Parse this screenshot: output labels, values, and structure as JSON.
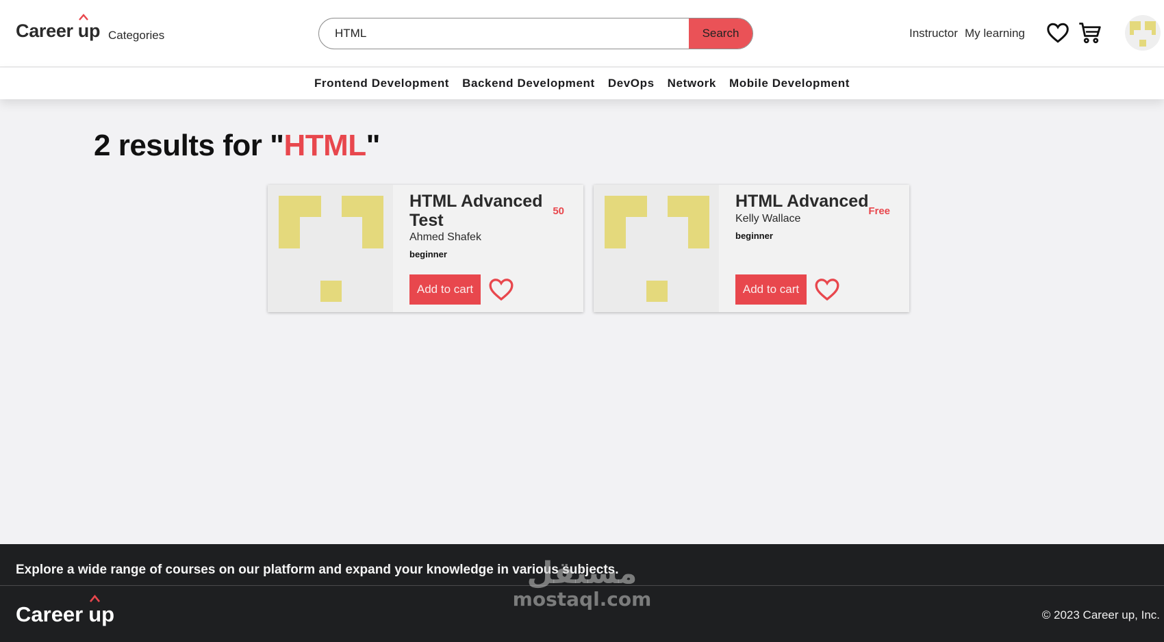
{
  "brand": {
    "name_part1": "Career",
    "name_part2": "up",
    "accent": "#e8474d",
    "logo_yellow": "#e4d97c"
  },
  "header": {
    "categories_label": "Categories",
    "search": {
      "value": "HTML",
      "button_label": "Search"
    },
    "nav": {
      "instructor": "Instructor",
      "my_learning": "My learning"
    },
    "icons": [
      "heart-icon",
      "cart-icon",
      "avatar"
    ]
  },
  "subnav": {
    "items": [
      {
        "label": "Frontend Development"
      },
      {
        "label": "Backend Development"
      },
      {
        "label": "DevOps"
      },
      {
        "label": "Network"
      },
      {
        "label": "Mobile Development"
      }
    ]
  },
  "results": {
    "count_text": "2 results for \"",
    "query": "HTML",
    "close_quote": "\""
  },
  "courses": [
    {
      "title": "HTML Advanced Test",
      "price": "50",
      "author": "Ahmed Shafek",
      "level": "beginner",
      "cart_label": "Add to cart"
    },
    {
      "title": "HTML Advanced",
      "price": "Free",
      "author": "Kelly Wallace",
      "level": "beginner",
      "cart_label": "Add to cart"
    }
  ],
  "footer": {
    "tagline": "Explore a wide range of courses on our platform and expand your knowledge in various subjects.",
    "copyright": "© 2023 Career up, Inc."
  },
  "watermark": {
    "arabic": "مستقل",
    "latin": "mostaql.com"
  }
}
